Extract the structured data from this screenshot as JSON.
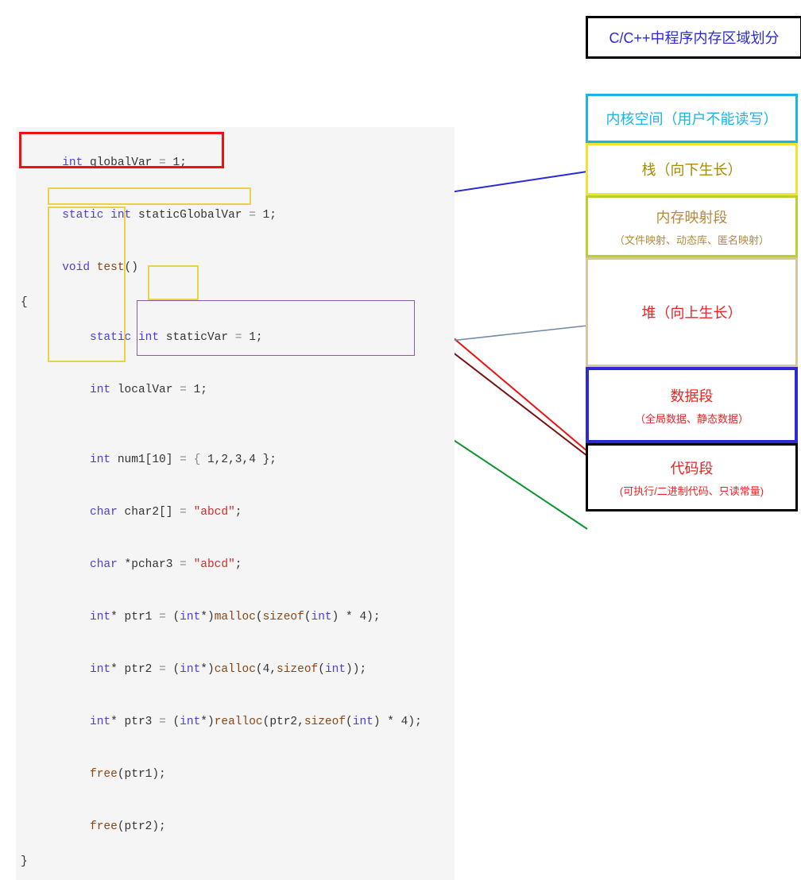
{
  "header": "C/C++中程序内存区域划分",
  "code": {
    "l1": {
      "kw_int": "int",
      "name": " globalVar ",
      "eq": "= ",
      "val": "1",
      "semi": ";"
    },
    "l2": {
      "kw_static": "static",
      "sp": " ",
      "kw_int": "int",
      "name": " staticGlobalVar ",
      "eq": "= ",
      "val": "1",
      "semi": ";"
    },
    "l3": {
      "kw_void": "void",
      "fn": " test",
      "paren": "()"
    },
    "l4": "{",
    "l5": {
      "ind": "    ",
      "kw_static": "static",
      "sp": " ",
      "kw_int": "int",
      "name": " staticVar ",
      "eq": "= ",
      "val": "1",
      "semi": ";"
    },
    "l6": {
      "ind": "    ",
      "kw_int": "int",
      "name": " localVar ",
      "eq": "= ",
      "val": "1",
      "semi": ";"
    },
    "l7": "",
    "l8": {
      "ind": "    ",
      "kw_int": "int",
      "name": " num1",
      "br": "[",
      "sz": "10",
      "br2": "]",
      " eq": " = { ",
      "vals": "1,2,3,4",
      "end": " };"
    },
    "l9": {
      "ind": "    ",
      "kw_char": "char",
      "name": " char2",
      "br": "[]",
      " eq": " = ",
      "str": "\"abcd\"",
      "semi": ";"
    },
    "l10": {
      "ind": "    ",
      "kw_char": "char",
      "star": " *",
      "name": "pchar3 ",
      "eq": "= ",
      "str": "\"abcd\"",
      "semi": ";"
    },
    "l11": {
      "ind": "    ",
      "kw_int": "int",
      "star": "*",
      "name": " ptr1 ",
      "eq": "= ",
      "cast": "(",
      "kw_int2": "int",
      "star2": "*",
      "castc": ")",
      "call": "malloc",
      "args": "(",
      "sz": "sizeof",
      "p": "(",
      "kw_int3": "int",
      "p2": ")",
      " mul": " * ",
      "n": "4",
      "end": ");"
    },
    "l12": {
      "ind": "    ",
      "kw_int": "int",
      "star": "*",
      "name": " ptr2 ",
      "eq": "= ",
      "cast": "(",
      "kw_int2": "int",
      "star2": "*",
      "castc": ")",
      "call": "calloc",
      "args": "(",
      "n1": "4",
      "c": ",",
      "sz": "sizeof",
      "p": "(",
      "kw_int3": "int",
      "p2": ")",
      "end": ");"
    },
    "l13": {
      "ind": "    ",
      "kw_int": "int",
      "star": "*",
      "name": " ptr3 ",
      "eq": "= ",
      "cast": "(",
      "kw_int2": "int",
      "star2": "*",
      "castc": ")",
      "call": "realloc",
      "args": "(",
      "a1": "ptr2",
      "c": ",",
      "sz": "sizeof",
      "p": "(",
      "kw_int3": "int",
      "p2": ")",
      " mul": " * ",
      "n": "4",
      "end": ");"
    },
    "l14": {
      "ind": "    ",
      "call": "free",
      "arg": "(ptr1);"
    },
    "l15": {
      "ind": "    ",
      "call": "free",
      "arg": "(ptr2);"
    },
    "l16": "}"
  },
  "mem": {
    "kernel": {
      "t1": "内核空间",
      "t1b": "（用户不能读写）"
    },
    "stack": {
      "t1": "栈",
      "t1b": "（向下生长）"
    },
    "mmap": {
      "t1": "内存映射段",
      "t2": "（文件映射、动态库、匿名映射）"
    },
    "heap": {
      "t1": "堆",
      "t1b": "（向上生长）"
    },
    "data": {
      "t1": "数据段",
      "t2": "（全局数据、静态数据）"
    },
    "code": {
      "t1": "代码段",
      "t2": "(可执行/二进制代码、只读常量)"
    }
  }
}
